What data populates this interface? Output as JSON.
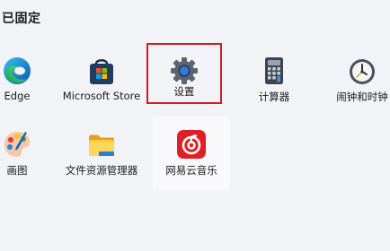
{
  "section": {
    "title": "已固定"
  },
  "apps": [
    {
      "label": "Edge",
      "icon": "edge-icon"
    },
    {
      "label": "Microsoft Store",
      "icon": "store-icon"
    },
    {
      "label": "设置",
      "icon": "settings-gear-icon"
    },
    {
      "label": "计算器",
      "icon": "calculator-icon"
    },
    {
      "label": "闹钟和时钟",
      "icon": "alarm-clock-icon"
    },
    {
      "label": "画图",
      "icon": "paint-icon"
    },
    {
      "label": "文件资源管理器",
      "icon": "folder-icon"
    },
    {
      "label": "网易云音乐",
      "icon": "netease-music-icon"
    }
  ],
  "colors": {
    "highlight": "#d51a23"
  }
}
